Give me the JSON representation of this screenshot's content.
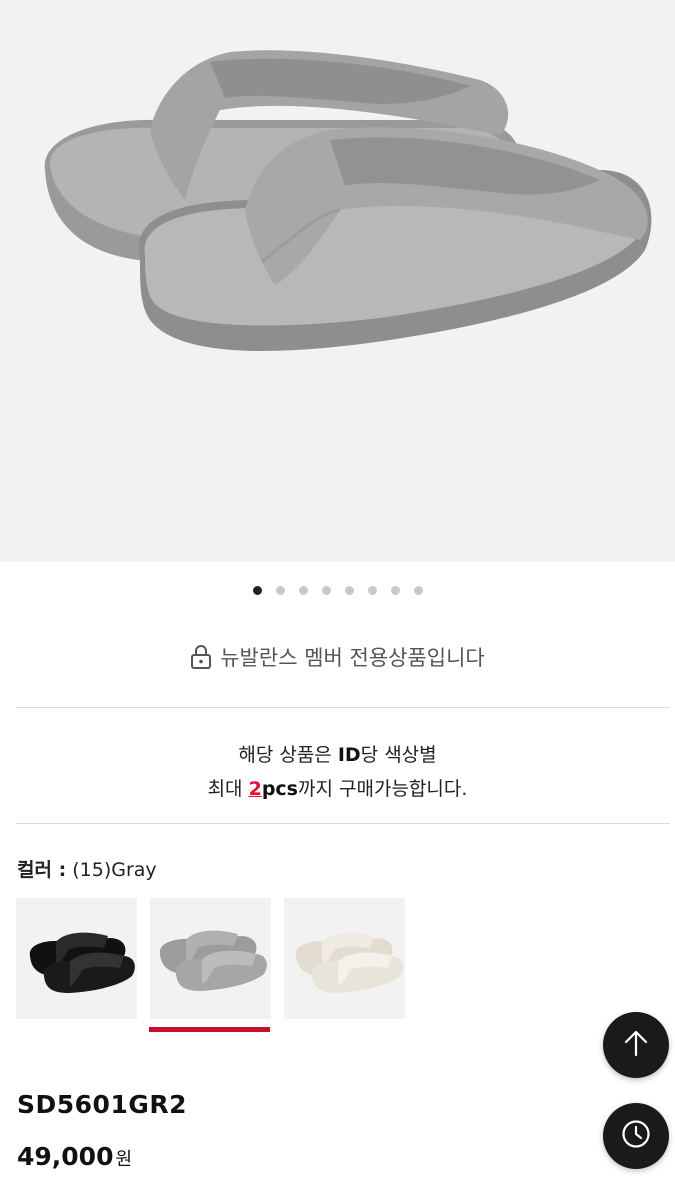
{
  "product": {
    "image_alt": "Gray flip-flop sandals",
    "gallery_total": 8,
    "gallery_active": 1
  },
  "member_notice": {
    "icon": "lock-icon",
    "text": "뉴발란스 멤버 전용상품입니다"
  },
  "purchase_limit": {
    "prefix": "해당 상품은 ",
    "id_label": "ID",
    "line1_suffix": "당 색상별",
    "line2_prefix": "최대 ",
    "qty_num": "2",
    "qty_unit": "pcs",
    "line2_suffix": "까지 구매가능합니다."
  },
  "color": {
    "label": "컬러 :",
    "selected": "(15)Gray",
    "options": [
      {
        "name": "Black",
        "tone": "#1c1c1c"
      },
      {
        "name": "Gray",
        "tone": "#a7a7a7"
      },
      {
        "name": "Ivory",
        "tone": "#ece8de"
      }
    ],
    "selected_index": 1,
    "accent": "#c8102e"
  },
  "sku": "SD5601GR2",
  "price": {
    "amount": "49,000",
    "unit": "원"
  },
  "fab": {
    "top_icon": "arrow-up-icon",
    "recent_icon": "clock-icon"
  }
}
